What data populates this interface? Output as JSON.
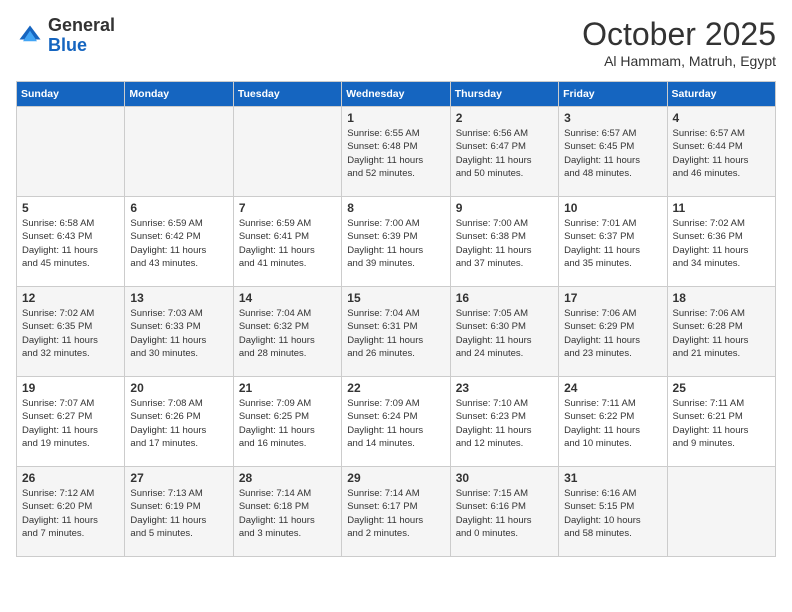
{
  "header": {
    "logo_general": "General",
    "logo_blue": "Blue",
    "month_title": "October 2025",
    "subtitle": "Al Hammam, Matruh, Egypt"
  },
  "days_of_week": [
    "Sunday",
    "Monday",
    "Tuesday",
    "Wednesday",
    "Thursday",
    "Friday",
    "Saturday"
  ],
  "weeks": [
    [
      {
        "day": "",
        "info": ""
      },
      {
        "day": "",
        "info": ""
      },
      {
        "day": "",
        "info": ""
      },
      {
        "day": "1",
        "info": "Sunrise: 6:55 AM\nSunset: 6:48 PM\nDaylight: 11 hours\nand 52 minutes."
      },
      {
        "day": "2",
        "info": "Sunrise: 6:56 AM\nSunset: 6:47 PM\nDaylight: 11 hours\nand 50 minutes."
      },
      {
        "day": "3",
        "info": "Sunrise: 6:57 AM\nSunset: 6:45 PM\nDaylight: 11 hours\nand 48 minutes."
      },
      {
        "day": "4",
        "info": "Sunrise: 6:57 AM\nSunset: 6:44 PM\nDaylight: 11 hours\nand 46 minutes."
      }
    ],
    [
      {
        "day": "5",
        "info": "Sunrise: 6:58 AM\nSunset: 6:43 PM\nDaylight: 11 hours\nand 45 minutes."
      },
      {
        "day": "6",
        "info": "Sunrise: 6:59 AM\nSunset: 6:42 PM\nDaylight: 11 hours\nand 43 minutes."
      },
      {
        "day": "7",
        "info": "Sunrise: 6:59 AM\nSunset: 6:41 PM\nDaylight: 11 hours\nand 41 minutes."
      },
      {
        "day": "8",
        "info": "Sunrise: 7:00 AM\nSunset: 6:39 PM\nDaylight: 11 hours\nand 39 minutes."
      },
      {
        "day": "9",
        "info": "Sunrise: 7:00 AM\nSunset: 6:38 PM\nDaylight: 11 hours\nand 37 minutes."
      },
      {
        "day": "10",
        "info": "Sunrise: 7:01 AM\nSunset: 6:37 PM\nDaylight: 11 hours\nand 35 minutes."
      },
      {
        "day": "11",
        "info": "Sunrise: 7:02 AM\nSunset: 6:36 PM\nDaylight: 11 hours\nand 34 minutes."
      }
    ],
    [
      {
        "day": "12",
        "info": "Sunrise: 7:02 AM\nSunset: 6:35 PM\nDaylight: 11 hours\nand 32 minutes."
      },
      {
        "day": "13",
        "info": "Sunrise: 7:03 AM\nSunset: 6:33 PM\nDaylight: 11 hours\nand 30 minutes."
      },
      {
        "day": "14",
        "info": "Sunrise: 7:04 AM\nSunset: 6:32 PM\nDaylight: 11 hours\nand 28 minutes."
      },
      {
        "day": "15",
        "info": "Sunrise: 7:04 AM\nSunset: 6:31 PM\nDaylight: 11 hours\nand 26 minutes."
      },
      {
        "day": "16",
        "info": "Sunrise: 7:05 AM\nSunset: 6:30 PM\nDaylight: 11 hours\nand 24 minutes."
      },
      {
        "day": "17",
        "info": "Sunrise: 7:06 AM\nSunset: 6:29 PM\nDaylight: 11 hours\nand 23 minutes."
      },
      {
        "day": "18",
        "info": "Sunrise: 7:06 AM\nSunset: 6:28 PM\nDaylight: 11 hours\nand 21 minutes."
      }
    ],
    [
      {
        "day": "19",
        "info": "Sunrise: 7:07 AM\nSunset: 6:27 PM\nDaylight: 11 hours\nand 19 minutes."
      },
      {
        "day": "20",
        "info": "Sunrise: 7:08 AM\nSunset: 6:26 PM\nDaylight: 11 hours\nand 17 minutes."
      },
      {
        "day": "21",
        "info": "Sunrise: 7:09 AM\nSunset: 6:25 PM\nDaylight: 11 hours\nand 16 minutes."
      },
      {
        "day": "22",
        "info": "Sunrise: 7:09 AM\nSunset: 6:24 PM\nDaylight: 11 hours\nand 14 minutes."
      },
      {
        "day": "23",
        "info": "Sunrise: 7:10 AM\nSunset: 6:23 PM\nDaylight: 11 hours\nand 12 minutes."
      },
      {
        "day": "24",
        "info": "Sunrise: 7:11 AM\nSunset: 6:22 PM\nDaylight: 11 hours\nand 10 minutes."
      },
      {
        "day": "25",
        "info": "Sunrise: 7:11 AM\nSunset: 6:21 PM\nDaylight: 11 hours\nand 9 minutes."
      }
    ],
    [
      {
        "day": "26",
        "info": "Sunrise: 7:12 AM\nSunset: 6:20 PM\nDaylight: 11 hours\nand 7 minutes."
      },
      {
        "day": "27",
        "info": "Sunrise: 7:13 AM\nSunset: 6:19 PM\nDaylight: 11 hours\nand 5 minutes."
      },
      {
        "day": "28",
        "info": "Sunrise: 7:14 AM\nSunset: 6:18 PM\nDaylight: 11 hours\nand 3 minutes."
      },
      {
        "day": "29",
        "info": "Sunrise: 7:14 AM\nSunset: 6:17 PM\nDaylight: 11 hours\nand 2 minutes."
      },
      {
        "day": "30",
        "info": "Sunrise: 7:15 AM\nSunset: 6:16 PM\nDaylight: 11 hours\nand 0 minutes."
      },
      {
        "day": "31",
        "info": "Sunrise: 6:16 AM\nSunset: 5:15 PM\nDaylight: 10 hours\nand 58 minutes."
      },
      {
        "day": "",
        "info": ""
      }
    ]
  ]
}
